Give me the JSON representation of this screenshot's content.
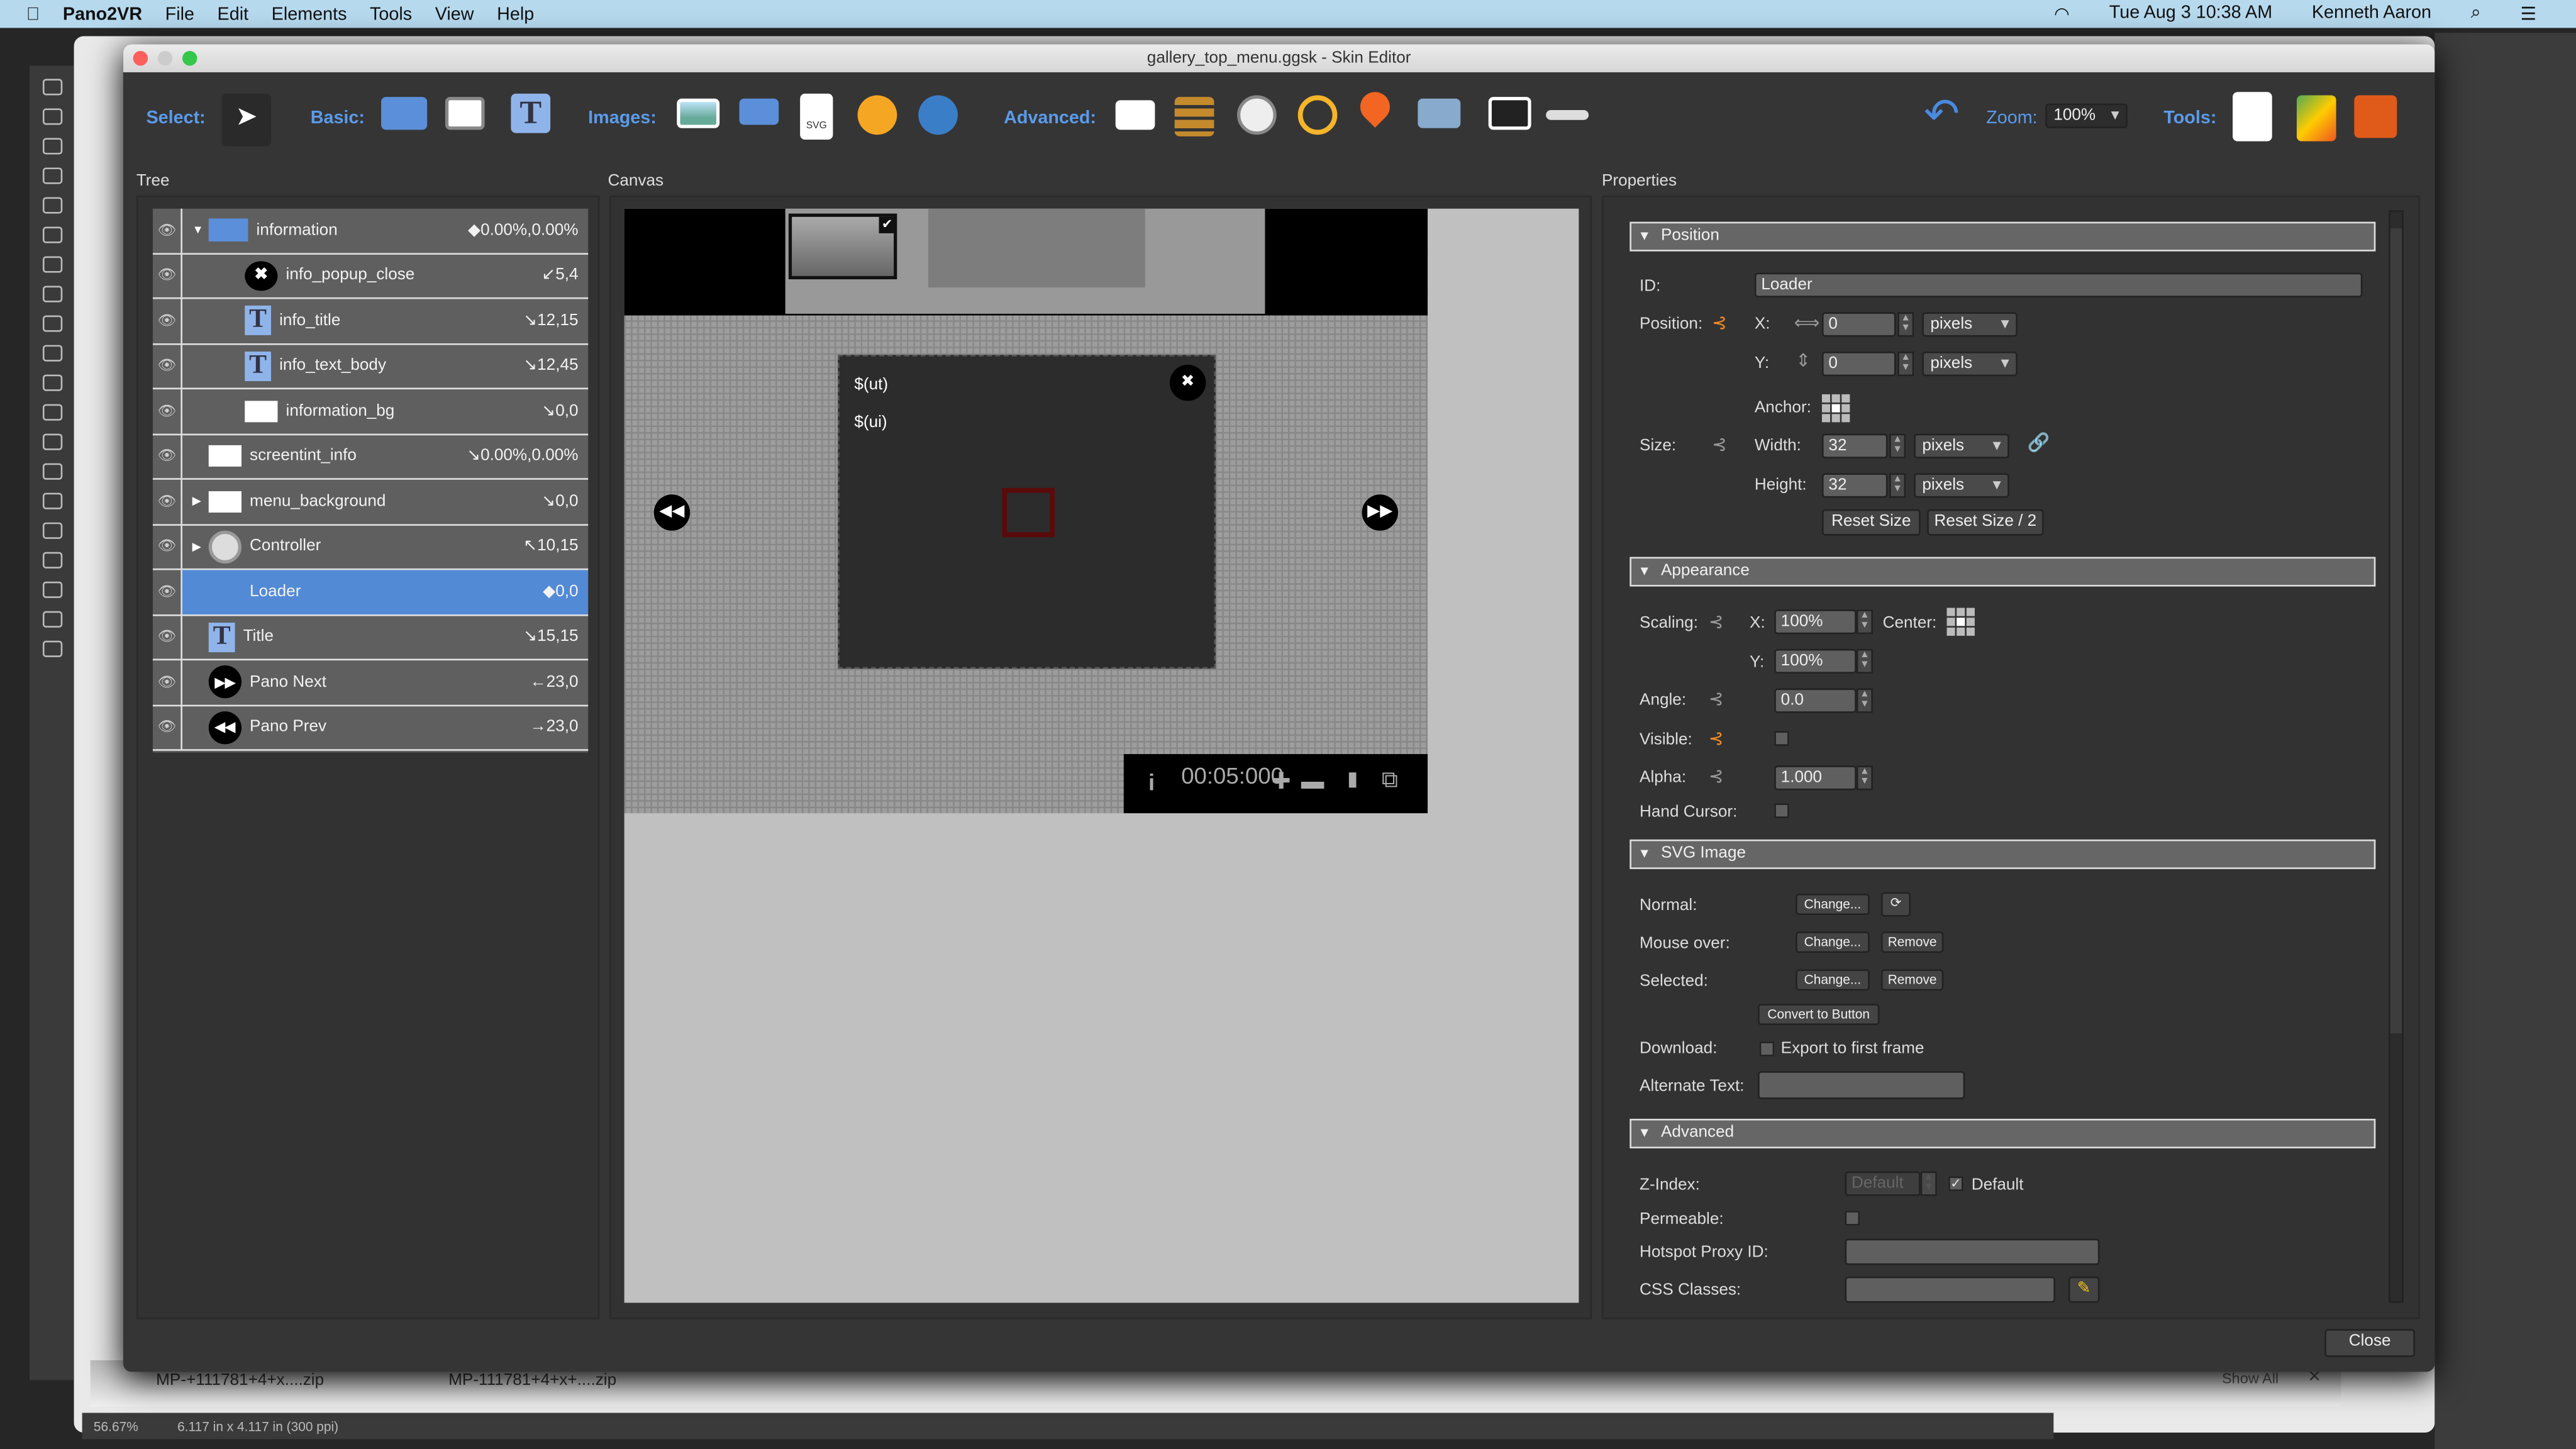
{
  "menubar": {
    "app": "Pano2VR",
    "items": [
      "File",
      "Edit",
      "Elements",
      "Tools",
      "View",
      "Help"
    ],
    "clock": "Tue Aug 3  10:38 AM",
    "user": "Kenneth Aaron"
  },
  "window": {
    "title": "gallery_top_menu.ggsk - Skin Editor"
  },
  "toolbar": {
    "select": "Select:",
    "basic": "Basic:",
    "images": "Images:",
    "advanced": "Advanced:",
    "zoom_label": "Zoom:",
    "zoom_value": "100%",
    "tools": "Tools:",
    "svg_badge": "SVG"
  },
  "panels": {
    "tree": "Tree",
    "canvas": "Canvas",
    "properties": "Properties"
  },
  "tree": [
    {
      "name": "information",
      "value": "◆0.00%,0.00%",
      "icon": "folder-icon",
      "expander": "▼",
      "indent": 0
    },
    {
      "name": "info_popup_close",
      "value": "↙5,4",
      "icon": "close-circle-icon",
      "expander": "",
      "indent": 2
    },
    {
      "name": "info_title",
      "value": "↘12,15",
      "icon": "text-icon",
      "expander": "",
      "indent": 2
    },
    {
      "name": "info_text_body",
      "value": "↘12,45",
      "icon": "text-icon",
      "expander": "",
      "indent": 2
    },
    {
      "name": "information_bg",
      "value": "↘0,0",
      "icon": "rectangle-icon",
      "expander": "",
      "indent": 2
    },
    {
      "name": "screentint_info",
      "value": "↘0.00%,0.00%",
      "icon": "rectangle-icon",
      "expander": "",
      "indent": 0
    },
    {
      "name": "menu_background",
      "value": "↘0,0",
      "icon": "rectangle-icon",
      "expander": "▶",
      "indent": 0
    },
    {
      "name": "Controller",
      "value": "↖10,15",
      "icon": "dial-icon",
      "expander": "▶",
      "indent": 0
    },
    {
      "name": "Loader",
      "value": "◆0,0",
      "icon": "",
      "expander": "",
      "indent": 0,
      "selected": true
    },
    {
      "name": "Title",
      "value": "↘15,15",
      "icon": "text-icon",
      "expander": "",
      "indent": 0
    },
    {
      "name": "Pano Next",
      "value": "←23,0",
      "icon": "fast-forward-icon",
      "expander": "",
      "indent": 0
    },
    {
      "name": "Pano Prev",
      "value": "→23,0",
      "icon": "rewind-icon",
      "expander": "",
      "indent": 0
    }
  ],
  "canvas": {
    "text1": "$(ut)",
    "text2": "$(ui)",
    "timer": "00:05:000"
  },
  "position": {
    "header": "Position",
    "id_label": "ID:",
    "id": "Loader",
    "position_label": "Position:",
    "x_label": "X:",
    "x": "0",
    "x_unit": "pixels",
    "y_label": "Y:",
    "y": "0",
    "y_unit": "pixels",
    "anchor_label": "Anchor:",
    "size_label": "Size:",
    "width_label": "Width:",
    "width": "32",
    "width_unit": "pixels",
    "height_label": "Height:",
    "height": "32",
    "height_unit": "pixels",
    "reset": "Reset Size",
    "reset_half": "Reset Size / 2"
  },
  "appearance": {
    "header": "Appearance",
    "scaling_label": "Scaling:",
    "sx_label": "X:",
    "sx": "100%",
    "center_label": "Center:",
    "sy_label": "Y:",
    "sy": "100%",
    "angle_label": "Angle:",
    "angle": "0.0",
    "visible_label": "Visible:",
    "alpha_label": "Alpha:",
    "alpha": "1.000",
    "hand_label": "Hand Cursor:"
  },
  "svg": {
    "header": "SVG Image",
    "normal_label": "Normal:",
    "mouseover_label": "Mouse over:",
    "selected_label": "Selected:",
    "change": "Change...",
    "remove": "Remove",
    "convert": "Convert to Button",
    "download_label": "Download:",
    "export_first": "Export to first frame",
    "alt_label": "Alternate Text:",
    "alt": ""
  },
  "advanced": {
    "header": "Advanced",
    "zindex_label": "Z-Index:",
    "zindex_placeholder": "Default",
    "default_label": "Default",
    "permeable_label": "Permeable:",
    "proxy_label": "Hotspot Proxy ID:",
    "css_label": "CSS Classes:"
  },
  "footer": {
    "close": "Close"
  },
  "downloads": {
    "file1": "MP-+111781+4+x....zip",
    "file2": "MP-111781+4+x+....zip",
    "show_all": "Show All"
  },
  "statusbar": {
    "zoom": "56.67%",
    "doc": "6.117 in x 4.117 in (300 ppi)"
  },
  "colors": {
    "accent": "#528ad6",
    "label_blue": "#5b9bea",
    "linked_orange": "#f08a24"
  }
}
